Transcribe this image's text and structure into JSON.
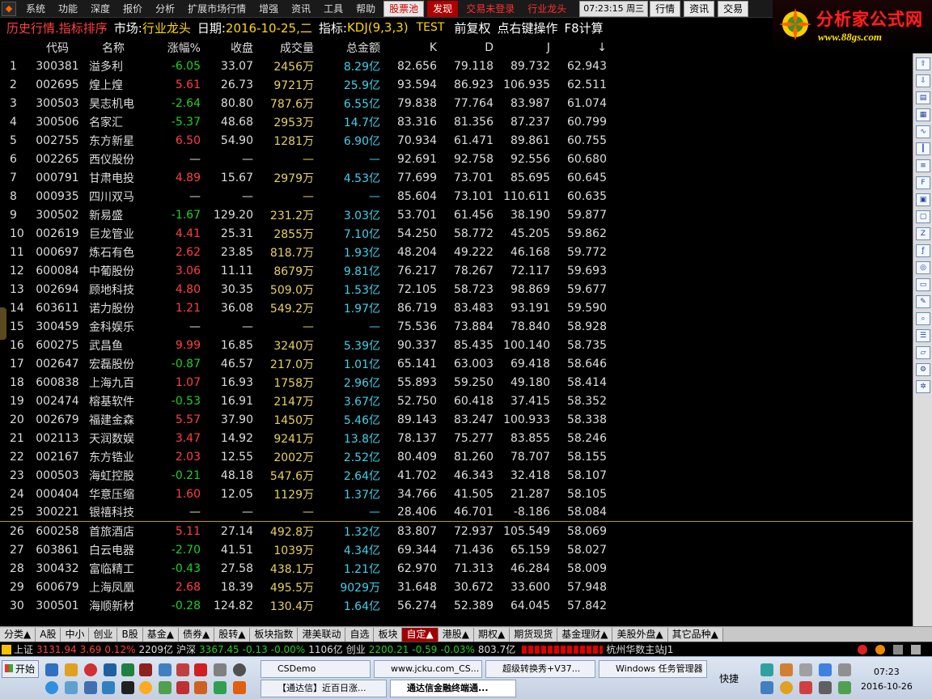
{
  "menubar": {
    "items": [
      "系统",
      "功能",
      "深度",
      "报价",
      "分析",
      "扩展市场行情",
      "增强",
      "资讯",
      "工具",
      "帮助"
    ],
    "btn_gupiaodi": "股票池",
    "btn_faxian": "发现",
    "btn_jiaoyi_weidenglu": "交易未登录",
    "btn_hangye_longtou": "行业龙头",
    "clock": "07:23:15 周三",
    "btn_hangqing": "行情",
    "btn_zixun": "资讯",
    "btn_jiaoyi": "交易"
  },
  "logo": {
    "main": "分析家公式网",
    "sub": "www.88gs.com"
  },
  "titlebar": {
    "part1": "历史行情.指标排序",
    "market_label": "市场:",
    "market_value": "行业龙头",
    "date_label": "日期:",
    "date_value": "2016-10-25,二",
    "indicator_label": "指标:",
    "indicator_value": "KDJ(9,3,3)",
    "test": "TEST",
    "fuquan": "前复权",
    "right_click": "点右键操作",
    "f8": "F8计算"
  },
  "table": {
    "headers": {
      "code": "代码",
      "name": "名称",
      "chg": "涨幅%",
      "close": "收盘",
      "vol": "成交量",
      "amt": "总金额",
      "k": "K",
      "d": "D",
      "j": "J",
      "sort": "↓"
    },
    "rows": [
      {
        "i": "1",
        "code": "300381",
        "name": "溢多利",
        "chg": "-6.05",
        "close": "33.07",
        "vol": "2456万",
        "amt": "8.29亿",
        "k": "82.656",
        "d": "79.118",
        "j": "89.732",
        "s": "62.943",
        "dir": "down"
      },
      {
        "i": "2",
        "code": "002695",
        "name": "煌上煌",
        "chg": "5.61",
        "close": "26.73",
        "vol": "9721万",
        "amt": "25.9亿",
        "k": "93.594",
        "d": "86.923",
        "j": "106.935",
        "s": "62.511",
        "dir": "up"
      },
      {
        "i": "3",
        "code": "300503",
        "name": "昊志机电",
        "chg": "-2.64",
        "close": "80.80",
        "vol": "787.6万",
        "amt": "6.55亿",
        "k": "79.838",
        "d": "77.764",
        "j": "83.987",
        "s": "61.074",
        "dir": "down"
      },
      {
        "i": "4",
        "code": "300506",
        "name": "名家汇",
        "chg": "-5.37",
        "close": "48.68",
        "vol": "2953万",
        "amt": "14.7亿",
        "k": "83.316",
        "d": "81.356",
        "j": "87.237",
        "s": "60.799",
        "dir": "down"
      },
      {
        "i": "5",
        "code": "002755",
        "name": "东方新星",
        "chg": "6.50",
        "close": "54.90",
        "vol": "1281万",
        "amt": "6.90亿",
        "k": "70.934",
        "d": "61.471",
        "j": "89.861",
        "s": "60.755",
        "dir": "up"
      },
      {
        "i": "6",
        "code": "002265",
        "name": "西仪股份",
        "chg": "—",
        "close": "—",
        "vol": "—",
        "amt": "—",
        "k": "92.691",
        "d": "92.758",
        "j": "92.556",
        "s": "60.680",
        "dir": "flat"
      },
      {
        "i": "7",
        "code": "000791",
        "name": "甘肃电投",
        "chg": "4.89",
        "close": "15.67",
        "vol": "2979万",
        "amt": "4.53亿",
        "k": "77.699",
        "d": "73.701",
        "j": "85.695",
        "s": "60.645",
        "dir": "up"
      },
      {
        "i": "8",
        "code": "000935",
        "name": "四川双马",
        "chg": "—",
        "close": "—",
        "vol": "—",
        "amt": "—",
        "k": "85.604",
        "d": "73.101",
        "j": "110.611",
        "s": "60.635",
        "dir": "flat"
      },
      {
        "i": "9",
        "code": "300502",
        "name": "新易盛",
        "chg": "-1.67",
        "close": "129.20",
        "vol": "231.2万",
        "amt": "3.03亿",
        "k": "53.701",
        "d": "61.456",
        "j": "38.190",
        "s": "59.877",
        "dir": "down"
      },
      {
        "i": "10",
        "code": "002619",
        "name": "巨龙管业",
        "chg": "4.41",
        "close": "25.31",
        "vol": "2855万",
        "amt": "7.10亿",
        "k": "54.250",
        "d": "58.772",
        "j": "45.205",
        "s": "59.862",
        "dir": "up"
      },
      {
        "i": "11",
        "code": "000697",
        "name": "炼石有色",
        "chg": "2.62",
        "close": "23.85",
        "vol": "818.7万",
        "amt": "1.93亿",
        "k": "48.204",
        "d": "49.222",
        "j": "46.168",
        "s": "59.772",
        "dir": "up"
      },
      {
        "i": "12",
        "code": "600084",
        "name": "中葡股份",
        "chg": "3.06",
        "close": "11.11",
        "vol": "8679万",
        "amt": "9.81亿",
        "k": "76.217",
        "d": "78.267",
        "j": "72.117",
        "s": "59.693",
        "dir": "up"
      },
      {
        "i": "13",
        "code": "002694",
        "name": "顾地科技",
        "chg": "4.80",
        "close": "30.35",
        "vol": "509.0万",
        "amt": "1.53亿",
        "k": "72.105",
        "d": "58.723",
        "j": "98.869",
        "s": "59.677",
        "dir": "up"
      },
      {
        "i": "14",
        "code": "603611",
        "name": "诺力股份",
        "chg": "1.21",
        "close": "36.08",
        "vol": "549.2万",
        "amt": "1.97亿",
        "k": "86.719",
        "d": "83.483",
        "j": "93.191",
        "s": "59.590",
        "dir": "up"
      },
      {
        "i": "15",
        "code": "300459",
        "name": "金科娱乐",
        "chg": "—",
        "close": "—",
        "vol": "—",
        "amt": "—",
        "k": "75.536",
        "d": "73.884",
        "j": "78.840",
        "s": "58.928",
        "dir": "flat"
      },
      {
        "i": "16",
        "code": "600275",
        "name": "武昌鱼",
        "chg": "9.99",
        "close": "16.85",
        "vol": "3240万",
        "amt": "5.39亿",
        "k": "90.337",
        "d": "85.435",
        "j": "100.140",
        "s": "58.735",
        "dir": "up"
      },
      {
        "i": "17",
        "code": "002647",
        "name": "宏磊股份",
        "chg": "-0.87",
        "close": "46.57",
        "vol": "217.0万",
        "amt": "1.01亿",
        "k": "65.141",
        "d": "63.003",
        "j": "69.418",
        "s": "58.646",
        "dir": "down"
      },
      {
        "i": "18",
        "code": "600838",
        "name": "上海九百",
        "chg": "1.07",
        "close": "16.93",
        "vol": "1758万",
        "amt": "2.96亿",
        "k": "55.893",
        "d": "59.250",
        "j": "49.180",
        "s": "58.414",
        "dir": "up"
      },
      {
        "i": "19",
        "code": "002474",
        "name": "榕基软件",
        "chg": "-0.53",
        "close": "16.91",
        "vol": "2147万",
        "amt": "3.67亿",
        "k": "52.750",
        "d": "60.418",
        "j": "37.415",
        "s": "58.352",
        "dir": "down"
      },
      {
        "i": "20",
        "code": "002679",
        "name": "福建金森",
        "chg": "5.57",
        "close": "37.90",
        "vol": "1450万",
        "amt": "5.46亿",
        "k": "89.143",
        "d": "83.247",
        "j": "100.933",
        "s": "58.338",
        "dir": "up"
      },
      {
        "i": "21",
        "code": "002113",
        "name": "天润数娱",
        "chg": "3.47",
        "close": "14.92",
        "vol": "9241万",
        "amt": "13.8亿",
        "k": "78.137",
        "d": "75.277",
        "j": "83.855",
        "s": "58.246",
        "dir": "up"
      },
      {
        "i": "22",
        "code": "002167",
        "name": "东方锆业",
        "chg": "2.03",
        "close": "12.55",
        "vol": "2002万",
        "amt": "2.52亿",
        "k": "80.409",
        "d": "81.260",
        "j": "78.707",
        "s": "58.155",
        "dir": "up"
      },
      {
        "i": "23",
        "code": "000503",
        "name": "海虹控股",
        "chg": "-0.21",
        "close": "48.18",
        "vol": "547.6万",
        "amt": "2.64亿",
        "k": "41.702",
        "d": "46.343",
        "j": "32.418",
        "s": "58.107",
        "dir": "down"
      },
      {
        "i": "24",
        "code": "000404",
        "name": "华意压缩",
        "chg": "1.60",
        "close": "12.05",
        "vol": "1129万",
        "amt": "1.37亿",
        "k": "34.766",
        "d": "41.505",
        "j": "21.287",
        "s": "58.105",
        "dir": "up"
      },
      {
        "i": "25",
        "code": "300221",
        "name": "银禧科技",
        "chg": "—",
        "close": "—",
        "vol": "—",
        "amt": "—",
        "k": "28.406",
        "d": "46.701",
        "j": "-8.186",
        "s": "58.084",
        "dir": "flat"
      },
      {
        "i": "26",
        "code": "600258",
        "name": "首旅酒店",
        "chg": "5.11",
        "close": "27.14",
        "vol": "492.8万",
        "amt": "1.32亿",
        "k": "83.807",
        "d": "72.937",
        "j": "105.549",
        "s": "58.069",
        "dir": "up"
      },
      {
        "i": "27",
        "code": "603861",
        "name": "白云电器",
        "chg": "-2.70",
        "close": "41.51",
        "vol": "1039万",
        "amt": "4.34亿",
        "k": "69.344",
        "d": "71.436",
        "j": "65.159",
        "s": "58.027",
        "dir": "down"
      },
      {
        "i": "28",
        "code": "300432",
        "name": "富临精工",
        "chg": "-0.43",
        "close": "27.58",
        "vol": "438.1万",
        "amt": "1.21亿",
        "k": "62.970",
        "d": "71.313",
        "j": "46.284",
        "s": "58.009",
        "dir": "down"
      },
      {
        "i": "29",
        "code": "600679",
        "name": "上海凤凰",
        "chg": "2.68",
        "close": "18.39",
        "vol": "495.5万",
        "amt": "9029万",
        "k": "31.648",
        "d": "30.672",
        "j": "33.600",
        "s": "57.948",
        "dir": "up"
      },
      {
        "i": "30",
        "code": "300501",
        "name": "海顺新材",
        "chg": "-0.28",
        "close": "124.82",
        "vol": "130.4万",
        "amt": "1.64亿",
        "k": "56.274",
        "d": "52.389",
        "j": "64.045",
        "s": "57.842",
        "dir": "down"
      }
    ]
  },
  "tabs": [
    "分类▲",
    "A股",
    "中小",
    "创业",
    "B股",
    "基金▲",
    "债券▲",
    "股转▲",
    "板块指数",
    "港美联动",
    "自选",
    "板块",
    "自定▲",
    "港股▲",
    "期权▲",
    "期货现货",
    "基金理财▲",
    "美股外盘▲",
    "其它品种▲"
  ],
  "active_tab": "自定▲",
  "status": {
    "sh_name": "上证",
    "sh_val": "3131.94",
    "sh_chg": "3.69",
    "sh_pct": "0.12%",
    "sh_amt": "2209亿",
    "hs_name": "沪深",
    "hs_val": "3367.45",
    "hs_chg": "-0.13",
    "hs_pct": "-0.00%",
    "hs_amt": "1106亿",
    "cy_name": "创业",
    "cy_val": "2200.21",
    "cy_chg": "-0.59",
    "cy_pct": "-0.03%",
    "cy_amt": "803.7亿",
    "server": "杭州华数主站J1"
  },
  "taskbar": {
    "start": "开始",
    "tasks": [
      "CSDemo",
      "www.jcku.com_CS...",
      "超级转换秀+V37...",
      "Windows 任务管理器",
      "【通达信】近百日涨...",
      "通达信金融终端通..."
    ],
    "quick_launch": "快捷",
    "time": "07:23",
    "date": "2016-10-26"
  },
  "colors": {
    "up": "#ff4040",
    "down": "#20d020",
    "volume": "#e8d060",
    "amount": "#40d0e8"
  }
}
